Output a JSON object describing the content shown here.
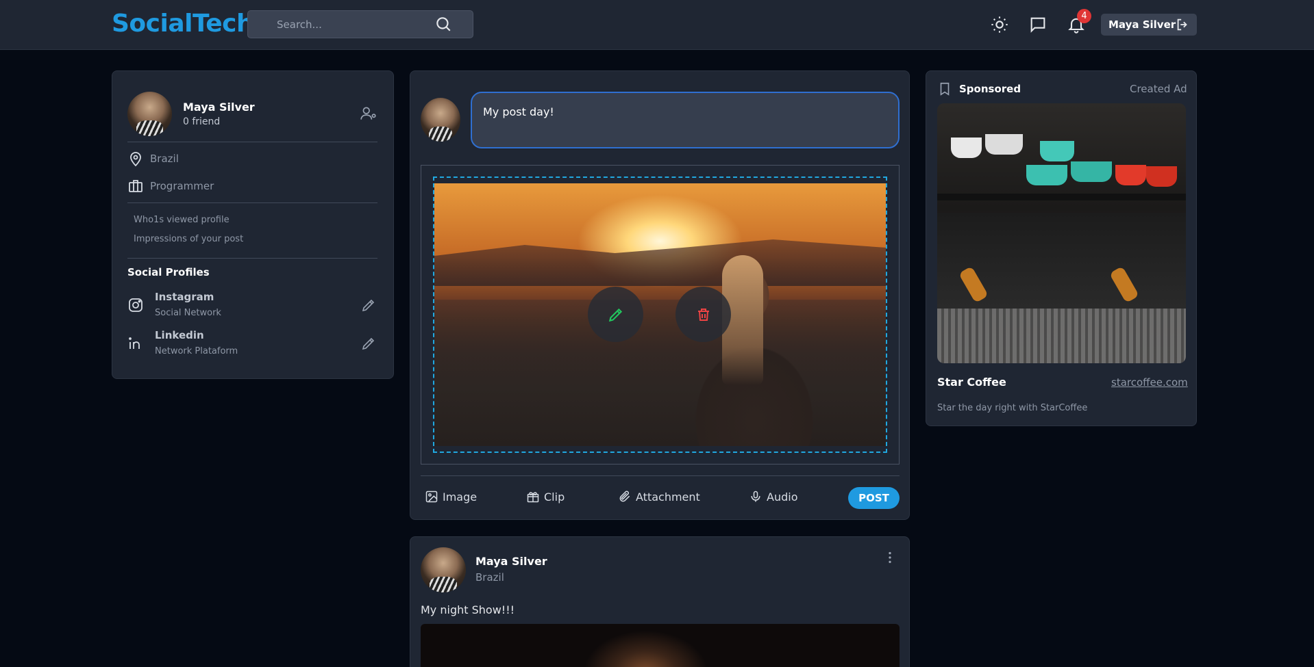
{
  "header": {
    "logo": "SocialTech",
    "search_placeholder": "Search...",
    "notification_count": "4",
    "user_name": "Maya Silver"
  },
  "profile": {
    "name": "Maya Silver",
    "friends": "0 friend",
    "location": "Brazil",
    "occupation": "Programmer",
    "stats": [
      "Who1s viewed profile",
      "Impressions of your post"
    ],
    "social_title": "Social Profiles",
    "social": [
      {
        "name": "Instagram",
        "sub": "Social Network",
        "icon": "instagram-icon"
      },
      {
        "name": "Linkedin",
        "sub": "Network Plataform",
        "icon": "linkedin-icon"
      }
    ]
  },
  "composer": {
    "text": "My post day!",
    "actions": [
      "Image",
      "Clip",
      "Attachment",
      "Audio"
    ],
    "post_label": "POST"
  },
  "feed_post": {
    "name": "Maya Silver",
    "location": "Brazil",
    "text": "My night Show!!!"
  },
  "ad": {
    "sponsored_label": "Sponsored",
    "created_label": "Created Ad",
    "title": "Star Coffee",
    "link": "starcoffee.com",
    "description": "Star the day right with StarCoffee"
  },
  "colors": {
    "accent": "#1f9ae0",
    "background": "#050a14",
    "card": "#1f2633",
    "badge": "#e03535",
    "edit": "#22c55e",
    "delete": "#ef4444"
  }
}
